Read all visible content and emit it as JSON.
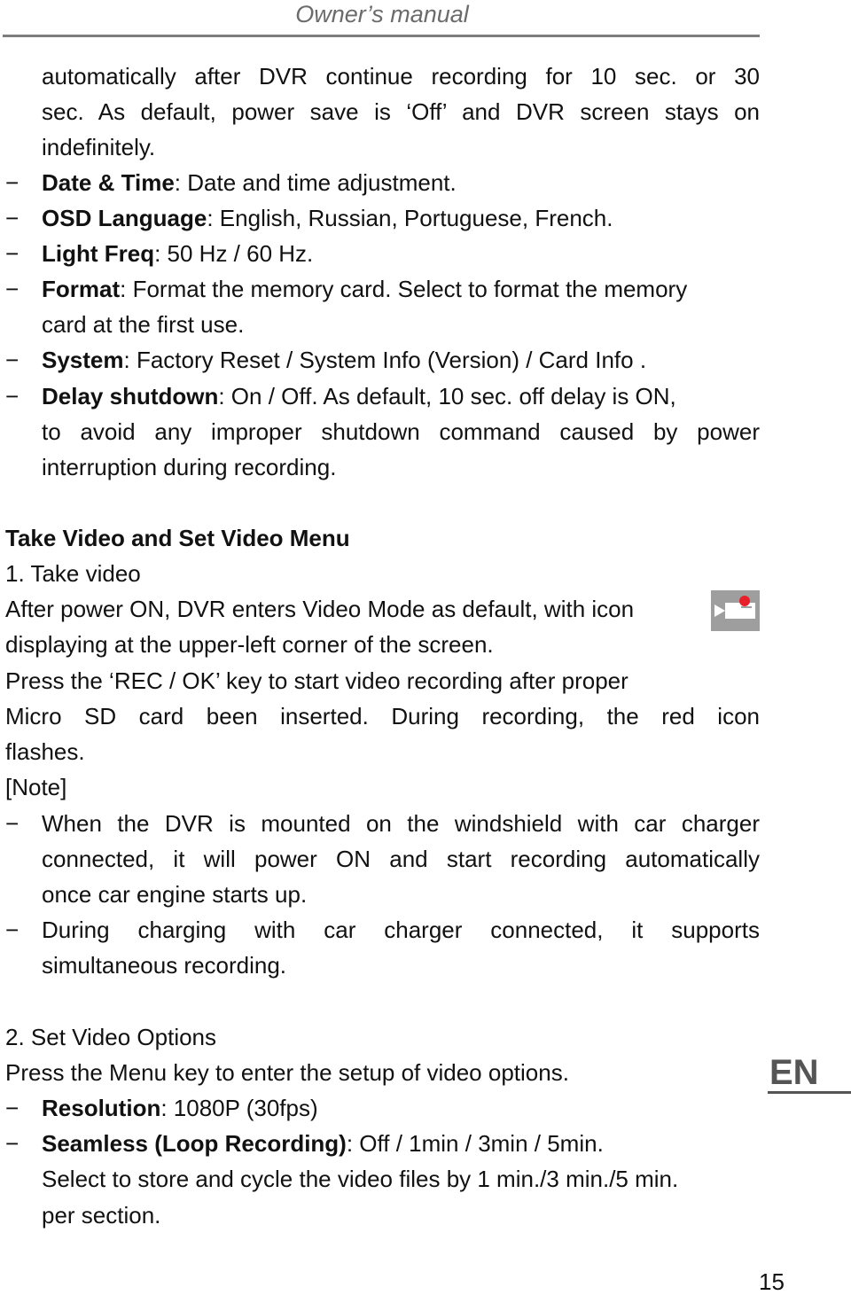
{
  "header": {
    "title": "Owner’s manual"
  },
  "settings_section": {
    "intro_lines": [
      "automatically after DVR continue recording for 10 sec. or 30",
      "sec. As default, power save is ‘Off’ and DVR screen stays on",
      "indefinitely."
    ],
    "items": [
      {
        "bullet": "−",
        "term": "Date & Time",
        "text": ": Date and time adjustment."
      },
      {
        "bullet": "−",
        "term": "OSD Language",
        "text": ": English, Russian, Portuguese, French."
      },
      {
        "bullet": "−",
        "term": "Light Freq",
        "text": ": 50 Hz / 60 Hz."
      },
      {
        "bullet": "−",
        "term": "Format",
        "text": ": Format the memory card. Select to format the memory",
        "cont": "card at the first use."
      },
      {
        "bullet": "−",
        "term": "System",
        "text": ": Factory Reset / System Info (Version) / Card Info ."
      },
      {
        "bullet": "−",
        "term": "Delay shutdown",
        "text": ": On / Off. As default, 10 sec. off delay is ON,",
        "cont": "to avoid any improper shutdown command caused by power",
        "cont2": "interruption during recording."
      }
    ]
  },
  "video_section": {
    "heading": "Take Video and Set Video Menu",
    "step1": {
      "title": "1. Take video",
      "lines": [
        "After power ON, DVR enters Video Mode as default, with icon",
        "displaying at the upper-left corner of the screen.",
        "Press the ‘REC / OK’ key to start video recording after proper",
        "Micro SD card been inserted. During recording, the red icon",
        "flashes.",
        "[Note]"
      ],
      "icon": "video-mode-icon",
      "notes": [
        {
          "bullet": "−",
          "lines": [
            "When the DVR is mounted on the windshield with car charger",
            "connected, it will power ON and start recording automatically",
            "once car engine starts up."
          ]
        },
        {
          "bullet": "−",
          "lines": [
            "During charging with car charger connected, it supports",
            "simultaneous recording."
          ]
        }
      ]
    },
    "step2": {
      "title": "2. Set Video Options",
      "intro": "Press the Menu key to enter the setup of video options.",
      "items": [
        {
          "bullet": "−",
          "term": "Resolution",
          "text": ": 1080P (30fps)"
        },
        {
          "bullet": "−",
          "term": "Seamless (Loop Recording)",
          "text": ": Off / 1min / 3min / 5min.",
          "cont": "Select to store and cycle the video files by 1 min./3 min./5 min.",
          "cont2": "per section."
        }
      ]
    }
  },
  "side_tab": {
    "label": "EN"
  },
  "footer": {
    "page_number": "15"
  },
  "colors": {
    "icon_bg": "#9e9e9e",
    "record_dot": "#e8202a",
    "tab": "#555555",
    "header": "#6b6b6b"
  }
}
